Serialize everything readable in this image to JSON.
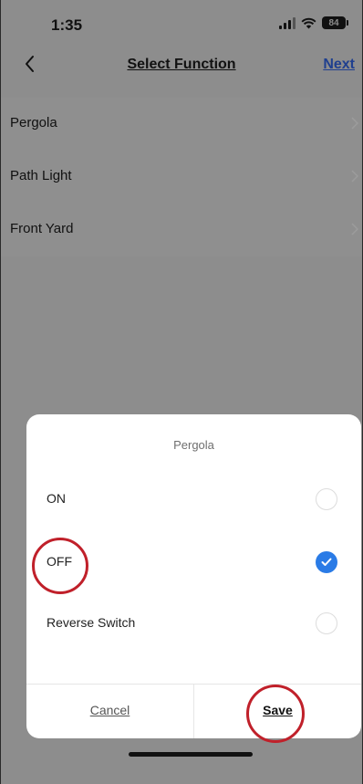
{
  "status_bar": {
    "time": "1:35",
    "battery": "84"
  },
  "nav": {
    "title": "Select Function",
    "next_label": "Next",
    "back_icon": "chevron-left-icon"
  },
  "list": {
    "items": [
      {
        "label": "Pergola"
      },
      {
        "label": "Path Light"
      },
      {
        "label": "Front Yard"
      }
    ]
  },
  "sheet": {
    "title": "Pergola",
    "options": [
      {
        "label": "ON",
        "selected": false
      },
      {
        "label": "OFF",
        "selected": true
      },
      {
        "label": "Reverse Switch",
        "selected": false
      }
    ],
    "cancel_label": "Cancel",
    "save_label": "Save"
  },
  "colors": {
    "accent": "#2a7be6",
    "link": "#1f3f8f",
    "highlight": "#c0202a",
    "overlay": "#8d8d8d"
  }
}
